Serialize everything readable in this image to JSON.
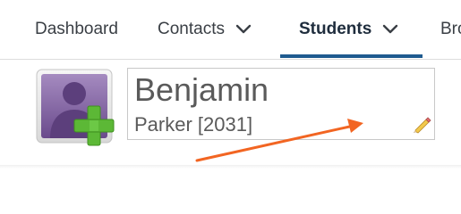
{
  "nav": {
    "items": [
      {
        "label": "Dashboard"
      },
      {
        "label": "Contacts"
      },
      {
        "label": "Students"
      },
      {
        "label": "Bro"
      }
    ]
  },
  "student": {
    "first_name": "Benjamin",
    "last_name_id": "Parker [2031]"
  },
  "icons": {
    "avatar": "add-contact-avatar-icon",
    "edit": "pencil-icon",
    "chevron": "chevron-down-icon"
  },
  "colors": {
    "accent": "#1f5b8f",
    "arrow": "#f26522",
    "avatar_purple": "#7a5a9a",
    "plus_green": "#5cb836"
  }
}
